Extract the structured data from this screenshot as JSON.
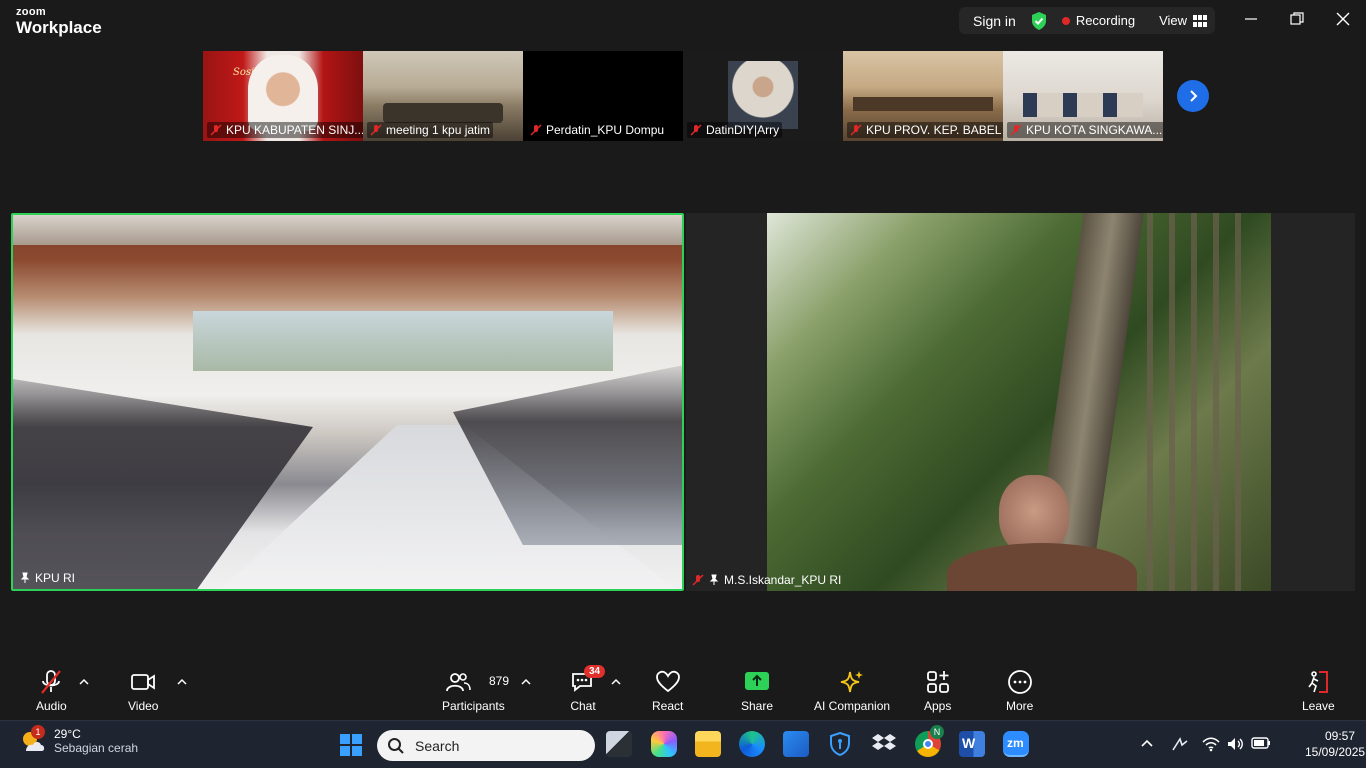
{
  "app": {
    "brand_small": "zoom",
    "brand_large": "Workplace"
  },
  "header": {
    "sign_in": "Sign in",
    "recording": "Recording",
    "view": "View",
    "colors": {
      "shield": "#2ed158",
      "record_dot": "#e02828"
    }
  },
  "thumbnails": [
    {
      "name": "KPU KABUPATEN SINJ...",
      "overlay": "Sosialisasi"
    },
    {
      "name": "meeting 1 kpu jatim"
    },
    {
      "name": "Perdatin_KPU Dompu"
    },
    {
      "name": "DatinDIY|Arry"
    },
    {
      "name": "KPU PROV. KEP. BABEL"
    },
    {
      "name": "KPU KOTA SINGKAWA..."
    }
  ],
  "main_videos": [
    {
      "name": "KPU RI",
      "active": true
    },
    {
      "name": "M.S.Iskandar_KPU RI",
      "active": false
    }
  ],
  "toolbar": {
    "audio": "Audio",
    "video": "Video",
    "participants": "Participants",
    "participant_count": "879",
    "chat": "Chat",
    "chat_badge": "34",
    "react": "React",
    "share": "Share",
    "ai_companion": "AI Companion",
    "apps": "Apps",
    "more": "More",
    "leave": "Leave",
    "colors": {
      "share": "#2ed158",
      "ai": "#f5c518",
      "leave": "#e02828"
    }
  },
  "taskbar": {
    "weather_temp": "29°C",
    "weather_cond": "Sebagian cerah",
    "weather_badge": "1",
    "search_placeholder": "Search",
    "time": "09:57",
    "date": "15/09/2025",
    "chrome_badge": "N"
  }
}
